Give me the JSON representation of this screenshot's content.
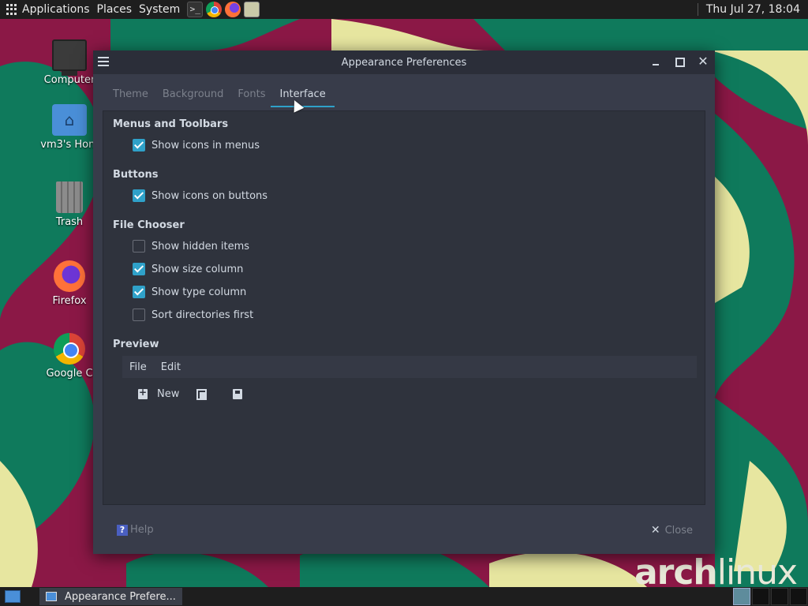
{
  "top_panel": {
    "menus": [
      "Applications",
      "Places",
      "System"
    ],
    "clock": "Thu Jul 27, 18:04"
  },
  "desktop": {
    "icons": [
      {
        "label": "Computer",
        "icon": "computer-icon"
      },
      {
        "label": "vm3's Hom",
        "icon": "home-folder-icon"
      },
      {
        "label": "Trash",
        "icon": "trash-icon"
      },
      {
        "label": "Firefox",
        "icon": "firefox-icon"
      },
      {
        "label": "Google C",
        "icon": "chrome-icon"
      }
    ],
    "logo": {
      "bold": "arch",
      "light": "linux"
    }
  },
  "window": {
    "title": "Appearance Preferences",
    "tabs": [
      {
        "label": "Theme",
        "active": false
      },
      {
        "label": "Background",
        "active": false
      },
      {
        "label": "Fonts",
        "active": false
      },
      {
        "label": "Interface",
        "active": true
      }
    ],
    "sections": {
      "menus_toolbars": {
        "title": "Menus and Toolbars",
        "options": [
          {
            "label": "Show icons in menus",
            "checked": true
          }
        ]
      },
      "buttons": {
        "title": "Buttons",
        "options": [
          {
            "label": "Show icons on buttons",
            "checked": true
          }
        ]
      },
      "file_chooser": {
        "title": "File Chooser",
        "options": [
          {
            "label": "Show hidden items",
            "checked": false
          },
          {
            "label": "Show size column",
            "checked": true
          },
          {
            "label": "Show type column",
            "checked": true
          },
          {
            "label": "Sort directories first",
            "checked": false
          }
        ]
      },
      "preview": {
        "title": "Preview",
        "menubar": [
          "File",
          "Edit"
        ],
        "toolbar_new_label": "New"
      }
    },
    "footer": {
      "help_label": "Help",
      "help_glyph": "?",
      "close_label": "Close"
    }
  },
  "taskbar": {
    "task_label": "Appearance Prefere..."
  },
  "colors": {
    "accent": "#2fa1c9",
    "window_bg": "#383c4a",
    "content_bg": "#2f333d"
  }
}
